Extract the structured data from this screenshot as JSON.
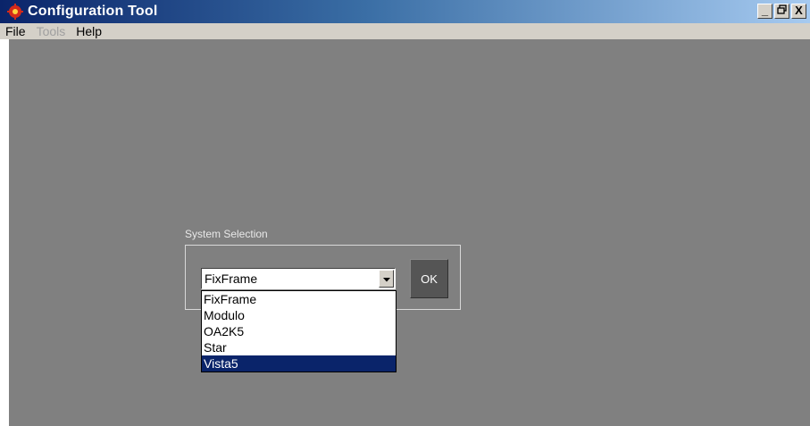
{
  "window": {
    "title": "Configuration Tool",
    "app_icon": "gear-icon",
    "controls": {
      "minimize_glyph": "_",
      "maximize_glyph": "▫",
      "close_glyph": "X"
    }
  },
  "menubar": {
    "items": [
      {
        "label": "File",
        "enabled": true
      },
      {
        "label": "Tools",
        "enabled": false
      },
      {
        "label": "Help",
        "enabled": true
      }
    ]
  },
  "system_selection": {
    "group_label": "System Selection",
    "selected_value": "FixFrame",
    "options": [
      "FixFrame",
      "Modulo",
      "OA2K5",
      "Star",
      "Vista5"
    ],
    "highlighted_option": "Vista5",
    "ok_label": "OK"
  },
  "colors": {
    "titlebar_start": "#0a246a",
    "titlebar_end": "#a6caf0",
    "client_background": "#808080",
    "highlight": "#0a246a",
    "ok_button": "#555555"
  }
}
